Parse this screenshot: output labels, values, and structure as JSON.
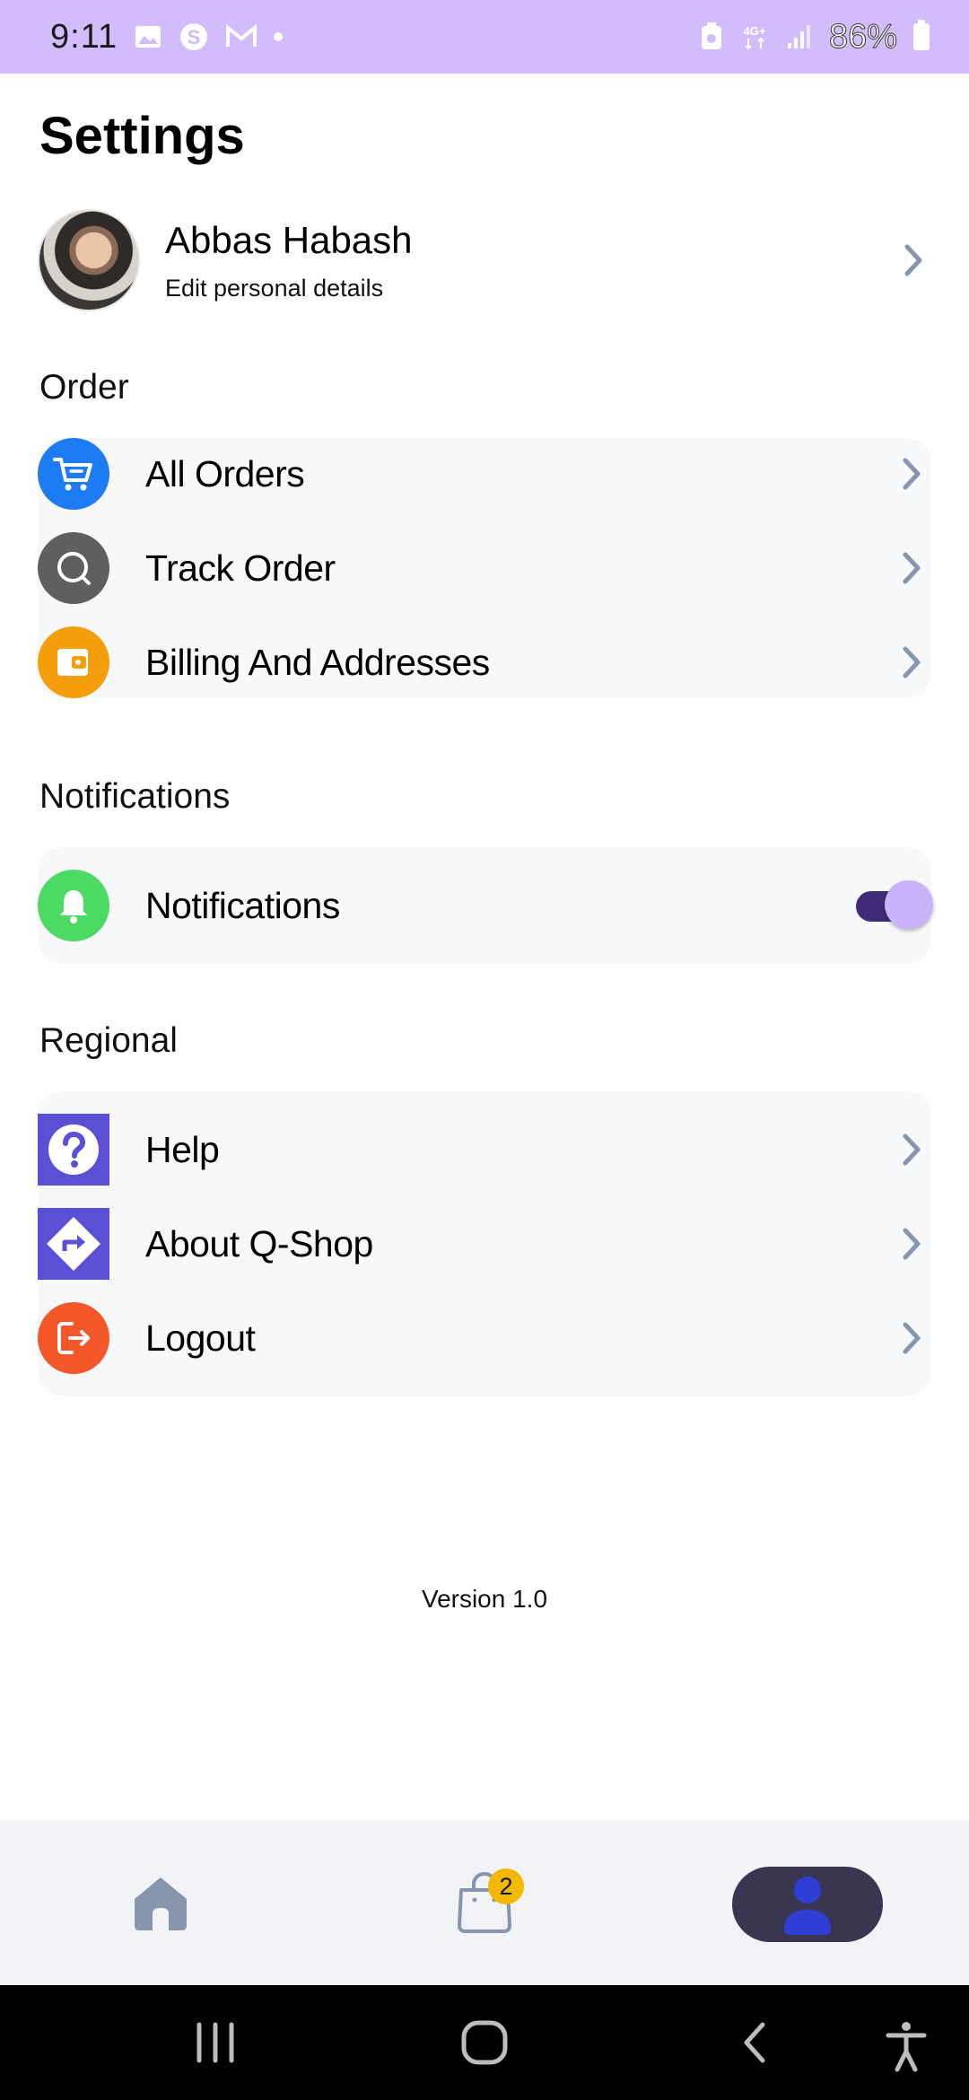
{
  "status_bar": {
    "time": "9:11",
    "battery_text": "86%",
    "network": "4G+"
  },
  "page": {
    "title": "Settings"
  },
  "profile": {
    "name": "Abbas Habash",
    "subtitle": "Edit personal details"
  },
  "sections": {
    "order": {
      "label": "Order",
      "items": [
        {
          "label": "All Orders",
          "icon": "cart-icon",
          "color": "#1e7cf2"
        },
        {
          "label": "Track Order",
          "icon": "search-icon",
          "color": "#5f5f5f"
        },
        {
          "label": "Billing And Addresses",
          "icon": "wallet-icon",
          "color": "#f59e0b"
        }
      ]
    },
    "notifications": {
      "label": "Notifications",
      "items": [
        {
          "label": "Notifications",
          "icon": "bell-icon",
          "color": "#4cd964",
          "toggle_on": true
        }
      ]
    },
    "regional": {
      "label": "Regional",
      "items": [
        {
          "label": "Help",
          "icon": "help-icon",
          "color": "#5b4fd6"
        },
        {
          "label": "About Q-Shop",
          "icon": "directions-icon",
          "color": "#5b4fd6"
        },
        {
          "label": "Logout",
          "icon": "logout-icon",
          "color": "#f4572a"
        }
      ]
    }
  },
  "footer": {
    "version": "Version 1.0"
  },
  "bottom_nav": {
    "items": [
      {
        "icon": "home-icon"
      },
      {
        "icon": "shopping-bag-icon",
        "badge": "2"
      },
      {
        "icon": "profile-icon",
        "active": true
      }
    ]
  },
  "colors": {
    "status_bar": "#d2bcfc",
    "accent_dark": "#3a3651",
    "toggle_track": "#3f2b77",
    "toggle_knob": "#c8b3fb"
  }
}
